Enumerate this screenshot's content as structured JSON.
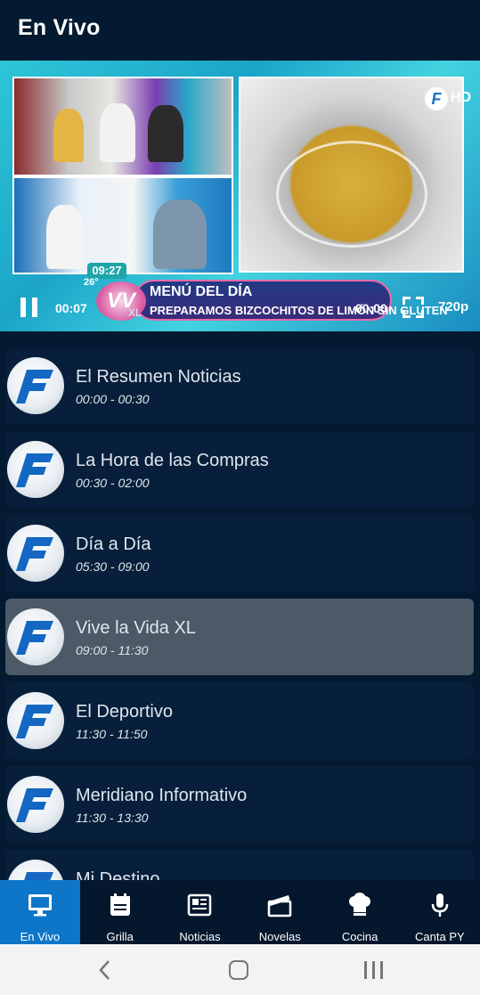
{
  "header": {
    "title": "En Vivo"
  },
  "player": {
    "current_time": "00:07",
    "end_time": "00:00",
    "quality": "720p",
    "overlay_clock": "09:27",
    "overlay_temp": "26°",
    "hd_badge": "HD",
    "channel_logo": "F",
    "show_logo": "VV",
    "show_logo_sub": "XL",
    "ticker_title": "MENÚ DEL DÍA",
    "ticker_subtitle": "PREPARAMOS BIZCOCHITOS DE LIMÓN SIN GLUTEN"
  },
  "programs": [
    {
      "title": "El Resumen Noticias",
      "time": "00:00 - 00:30",
      "active": false
    },
    {
      "title": "La Hora de las Compras",
      "time": "00:30 - 02:00",
      "active": false
    },
    {
      "title": "Día a Día",
      "time": "05:30 - 09:00",
      "active": false
    },
    {
      "title": "Vive la Vida XL",
      "time": "09:00 - 11:30",
      "active": true
    },
    {
      "title": "El Deportivo",
      "time": "11:30 - 11:50",
      "active": false
    },
    {
      "title": "Meridiano Informativo",
      "time": "11:30 - 13:30",
      "active": false
    },
    {
      "title": "Mi Destino",
      "time": "",
      "active": false
    }
  ],
  "nav": [
    {
      "label": "En Vivo",
      "icon": "monitor-icon",
      "active": true
    },
    {
      "label": "Grilla",
      "icon": "calendar-icon",
      "active": false
    },
    {
      "label": "Noticias",
      "icon": "newspaper-icon",
      "active": false
    },
    {
      "label": "Novelas",
      "icon": "clapperboard-icon",
      "active": false
    },
    {
      "label": "Cocina",
      "icon": "chef-hat-icon",
      "active": false
    },
    {
      "label": "Canta PY",
      "icon": "microphone-icon",
      "active": false
    }
  ],
  "colors": {
    "accent": "#0d76c9",
    "background": "#041a31",
    "active_row": "#4c5966"
  }
}
